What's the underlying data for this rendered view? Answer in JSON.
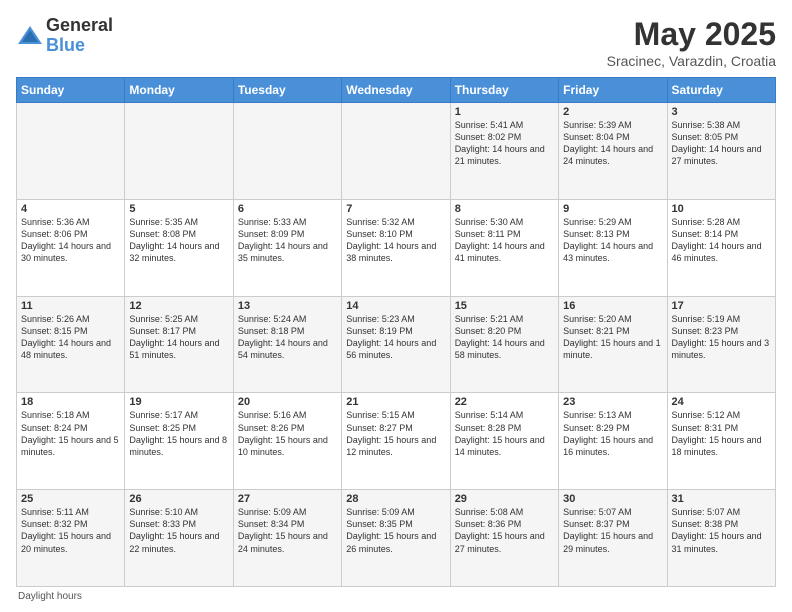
{
  "logo": {
    "general": "General",
    "blue": "Blue"
  },
  "title": {
    "month_year": "May 2025",
    "location": "Sracinec, Varazdin, Croatia"
  },
  "days_of_week": [
    "Sunday",
    "Monday",
    "Tuesday",
    "Wednesday",
    "Thursday",
    "Friday",
    "Saturday"
  ],
  "footer": {
    "daylight_hours": "Daylight hours"
  },
  "weeks": [
    [
      {
        "day": "",
        "info": ""
      },
      {
        "day": "",
        "info": ""
      },
      {
        "day": "",
        "info": ""
      },
      {
        "day": "",
        "info": ""
      },
      {
        "day": "1",
        "info": "Sunrise: 5:41 AM\nSunset: 8:02 PM\nDaylight: 14 hours and 21 minutes."
      },
      {
        "day": "2",
        "info": "Sunrise: 5:39 AM\nSunset: 8:04 PM\nDaylight: 14 hours and 24 minutes."
      },
      {
        "day": "3",
        "info": "Sunrise: 5:38 AM\nSunset: 8:05 PM\nDaylight: 14 hours and 27 minutes."
      }
    ],
    [
      {
        "day": "4",
        "info": "Sunrise: 5:36 AM\nSunset: 8:06 PM\nDaylight: 14 hours and 30 minutes."
      },
      {
        "day": "5",
        "info": "Sunrise: 5:35 AM\nSunset: 8:08 PM\nDaylight: 14 hours and 32 minutes."
      },
      {
        "day": "6",
        "info": "Sunrise: 5:33 AM\nSunset: 8:09 PM\nDaylight: 14 hours and 35 minutes."
      },
      {
        "day": "7",
        "info": "Sunrise: 5:32 AM\nSunset: 8:10 PM\nDaylight: 14 hours and 38 minutes."
      },
      {
        "day": "8",
        "info": "Sunrise: 5:30 AM\nSunset: 8:11 PM\nDaylight: 14 hours and 41 minutes."
      },
      {
        "day": "9",
        "info": "Sunrise: 5:29 AM\nSunset: 8:13 PM\nDaylight: 14 hours and 43 minutes."
      },
      {
        "day": "10",
        "info": "Sunrise: 5:28 AM\nSunset: 8:14 PM\nDaylight: 14 hours and 46 minutes."
      }
    ],
    [
      {
        "day": "11",
        "info": "Sunrise: 5:26 AM\nSunset: 8:15 PM\nDaylight: 14 hours and 48 minutes."
      },
      {
        "day": "12",
        "info": "Sunrise: 5:25 AM\nSunset: 8:17 PM\nDaylight: 14 hours and 51 minutes."
      },
      {
        "day": "13",
        "info": "Sunrise: 5:24 AM\nSunset: 8:18 PM\nDaylight: 14 hours and 54 minutes."
      },
      {
        "day": "14",
        "info": "Sunrise: 5:23 AM\nSunset: 8:19 PM\nDaylight: 14 hours and 56 minutes."
      },
      {
        "day": "15",
        "info": "Sunrise: 5:21 AM\nSunset: 8:20 PM\nDaylight: 14 hours and 58 minutes."
      },
      {
        "day": "16",
        "info": "Sunrise: 5:20 AM\nSunset: 8:21 PM\nDaylight: 15 hours and 1 minute."
      },
      {
        "day": "17",
        "info": "Sunrise: 5:19 AM\nSunset: 8:23 PM\nDaylight: 15 hours and 3 minutes."
      }
    ],
    [
      {
        "day": "18",
        "info": "Sunrise: 5:18 AM\nSunset: 8:24 PM\nDaylight: 15 hours and 5 minutes."
      },
      {
        "day": "19",
        "info": "Sunrise: 5:17 AM\nSunset: 8:25 PM\nDaylight: 15 hours and 8 minutes."
      },
      {
        "day": "20",
        "info": "Sunrise: 5:16 AM\nSunset: 8:26 PM\nDaylight: 15 hours and 10 minutes."
      },
      {
        "day": "21",
        "info": "Sunrise: 5:15 AM\nSunset: 8:27 PM\nDaylight: 15 hours and 12 minutes."
      },
      {
        "day": "22",
        "info": "Sunrise: 5:14 AM\nSunset: 8:28 PM\nDaylight: 15 hours and 14 minutes."
      },
      {
        "day": "23",
        "info": "Sunrise: 5:13 AM\nSunset: 8:29 PM\nDaylight: 15 hours and 16 minutes."
      },
      {
        "day": "24",
        "info": "Sunrise: 5:12 AM\nSunset: 8:31 PM\nDaylight: 15 hours and 18 minutes."
      }
    ],
    [
      {
        "day": "25",
        "info": "Sunrise: 5:11 AM\nSunset: 8:32 PM\nDaylight: 15 hours and 20 minutes."
      },
      {
        "day": "26",
        "info": "Sunrise: 5:10 AM\nSunset: 8:33 PM\nDaylight: 15 hours and 22 minutes."
      },
      {
        "day": "27",
        "info": "Sunrise: 5:09 AM\nSunset: 8:34 PM\nDaylight: 15 hours and 24 minutes."
      },
      {
        "day": "28",
        "info": "Sunrise: 5:09 AM\nSunset: 8:35 PM\nDaylight: 15 hours and 26 minutes."
      },
      {
        "day": "29",
        "info": "Sunrise: 5:08 AM\nSunset: 8:36 PM\nDaylight: 15 hours and 27 minutes."
      },
      {
        "day": "30",
        "info": "Sunrise: 5:07 AM\nSunset: 8:37 PM\nDaylight: 15 hours and 29 minutes."
      },
      {
        "day": "31",
        "info": "Sunrise: 5:07 AM\nSunset: 8:38 PM\nDaylight: 15 hours and 31 minutes."
      }
    ]
  ]
}
